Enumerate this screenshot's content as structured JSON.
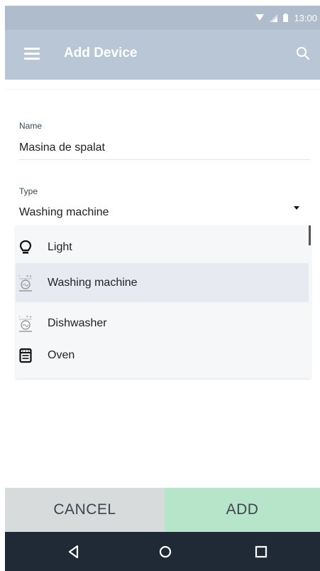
{
  "status_bar": {
    "time": "13:00"
  },
  "app_bar": {
    "title": "Add Device"
  },
  "form": {
    "name": {
      "label": "Name",
      "value": "Masina de spalat"
    },
    "type": {
      "label": "Type",
      "value": "Washing machine"
    }
  },
  "dropdown": {
    "options": [
      {
        "label": "Light",
        "icon": "lightbulb-icon"
      },
      {
        "label": "Washing machine",
        "icon": "washing-machine-icon",
        "selected": true
      },
      {
        "label": "Dishwasher",
        "icon": "dishwasher-icon"
      },
      {
        "label": "Oven",
        "icon": "oven-icon"
      }
    ]
  },
  "actions": {
    "cancel_label": "CANCEL",
    "add_label": "ADD"
  },
  "colors": {
    "app_bar": "#b8c6d6",
    "status_bar": "#aebccc",
    "cancel_bg": "#d7dbdb",
    "add_bg": "#b7e5ca",
    "nav_bar": "#1f2a36",
    "selected_option": "#e7eaf0"
  }
}
